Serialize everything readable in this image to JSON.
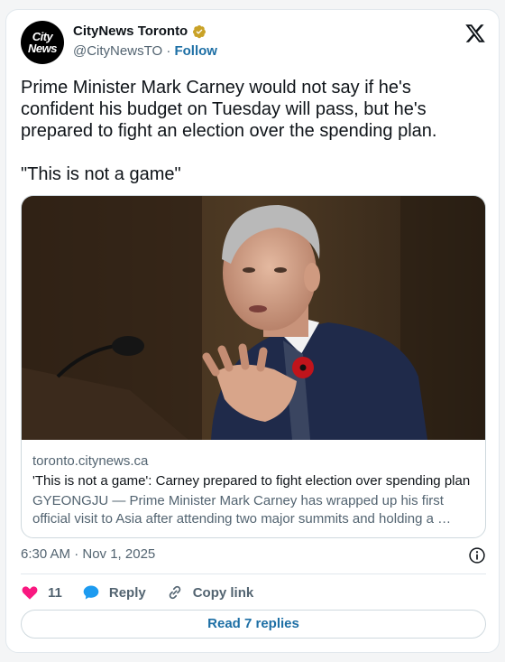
{
  "author": {
    "avatar_line1": "City",
    "avatar_line2": "News",
    "name": "CityNews Toronto",
    "handle": "@CityNewsTO",
    "separator": "·",
    "follow_label": "Follow",
    "verified_icon": "verified-badge-icon",
    "verified_color": "#c9a227"
  },
  "platform_icon": "x-logo-icon",
  "tweet": {
    "text": "Prime Minister Mark Carney would not say if he's confident his budget on Tuesday will pass, but he's prepared to fight an election over the spending plan.\n\n\"This is not a game\""
  },
  "link_card": {
    "domain": "toronto.citynews.ca",
    "title": "'This is not a game': Carney prepared to fight election over spending plan",
    "description": "GYEONGJU — Prime Minister Mark Carney has wrapped up his first official visit to Asia after attending two major summits and holding a …"
  },
  "timestamp": "6:30 AM · Nov 1, 2025",
  "actions": {
    "like_count": "11",
    "reply_label": "Reply",
    "copy_link_label": "Copy link"
  },
  "read_replies_label": "Read 7 replies",
  "colors": {
    "accent": "#1d6fa5",
    "like": "#f91880",
    "reply": "#1d9bf0"
  }
}
